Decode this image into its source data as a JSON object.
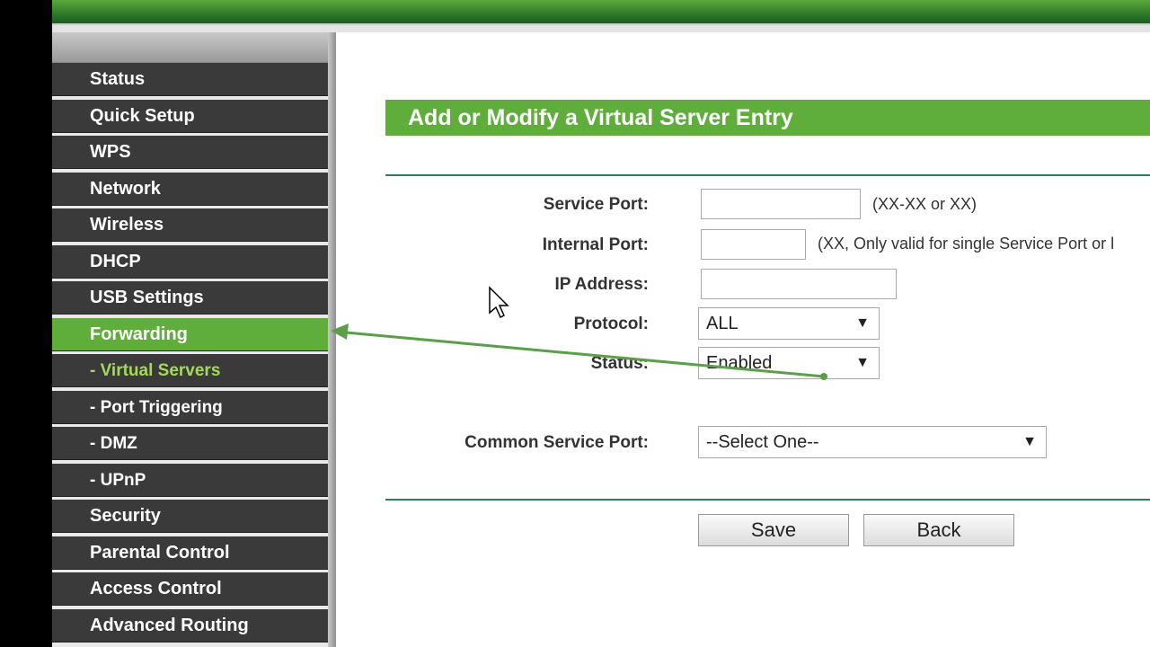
{
  "sidebar": {
    "items": [
      {
        "label": "Status"
      },
      {
        "label": "Quick Setup"
      },
      {
        "label": "WPS"
      },
      {
        "label": "Network"
      },
      {
        "label": "Wireless"
      },
      {
        "label": "DHCP"
      },
      {
        "label": "USB Settings"
      },
      {
        "label": "Forwarding"
      },
      {
        "label": "- Virtual Servers"
      },
      {
        "label": "- Port Triggering"
      },
      {
        "label": "- DMZ"
      },
      {
        "label": "- UPnP"
      },
      {
        "label": "Security"
      },
      {
        "label": "Parental Control"
      },
      {
        "label": "Access Control"
      },
      {
        "label": "Advanced Routing"
      }
    ]
  },
  "main": {
    "title": "Add or Modify a Virtual Server Entry",
    "service_port": {
      "label": "Service Port:",
      "value": "",
      "hint": "(XX-XX or XX)"
    },
    "internal_port": {
      "label": "Internal Port:",
      "value": "",
      "hint": "(XX, Only valid for single Service Port or l"
    },
    "ip_address": {
      "label": "IP Address:",
      "value": ""
    },
    "protocol": {
      "label": "Protocol:",
      "value": "ALL"
    },
    "status": {
      "label": "Status:",
      "value": "Enabled"
    },
    "common_service_port": {
      "label": "Common Service Port:",
      "value": "--Select One--"
    },
    "save_label": "Save",
    "back_label": "Back"
  },
  "colors": {
    "accent": "#5fae3b",
    "menu_bg": "#3a3a3a",
    "current_item": "#a6d85c"
  }
}
